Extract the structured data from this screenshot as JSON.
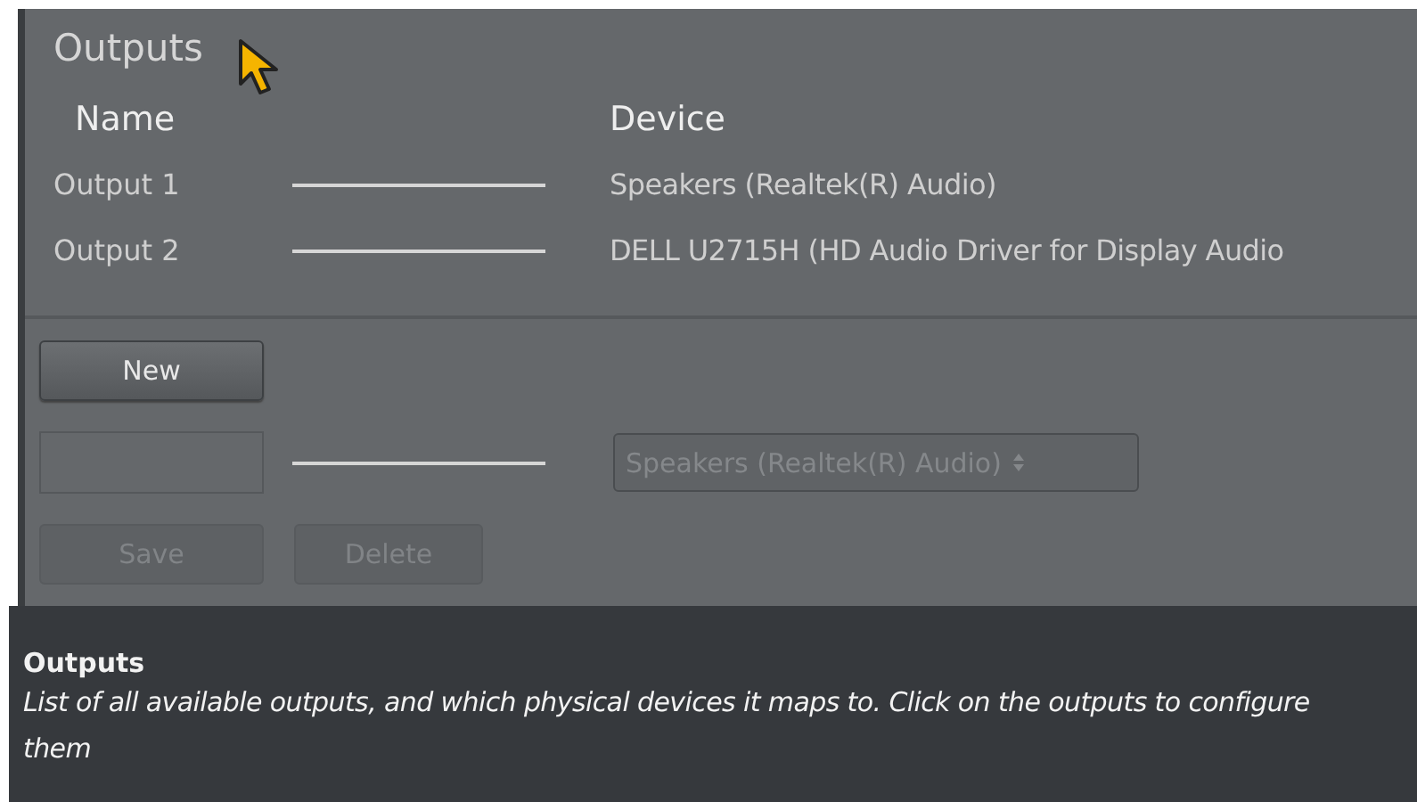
{
  "panel": {
    "title": "Outputs",
    "columns": [
      "Name",
      "Device"
    ],
    "outputs": [
      {
        "name": "Output 1",
        "device": "Speakers (Realtek(R) Audio)"
      },
      {
        "name": "Output 2",
        "device": "DELL U2715H (HD Audio Driver for Display Audio"
      }
    ],
    "new_button": {
      "label": "New",
      "disabled": false
    },
    "editor": {
      "device_select": {
        "value": "Speakers (Realtek(R) Audio)",
        "disabled": true
      },
      "buttons": [
        {
          "label": "Save",
          "disabled": true
        },
        {
          "label": "Delete",
          "disabled": true
        }
      ]
    }
  },
  "help": {
    "title": "Outputs",
    "text": "List of all available outputs, and which physical devices it maps to. Click on the outputs to configure them"
  }
}
